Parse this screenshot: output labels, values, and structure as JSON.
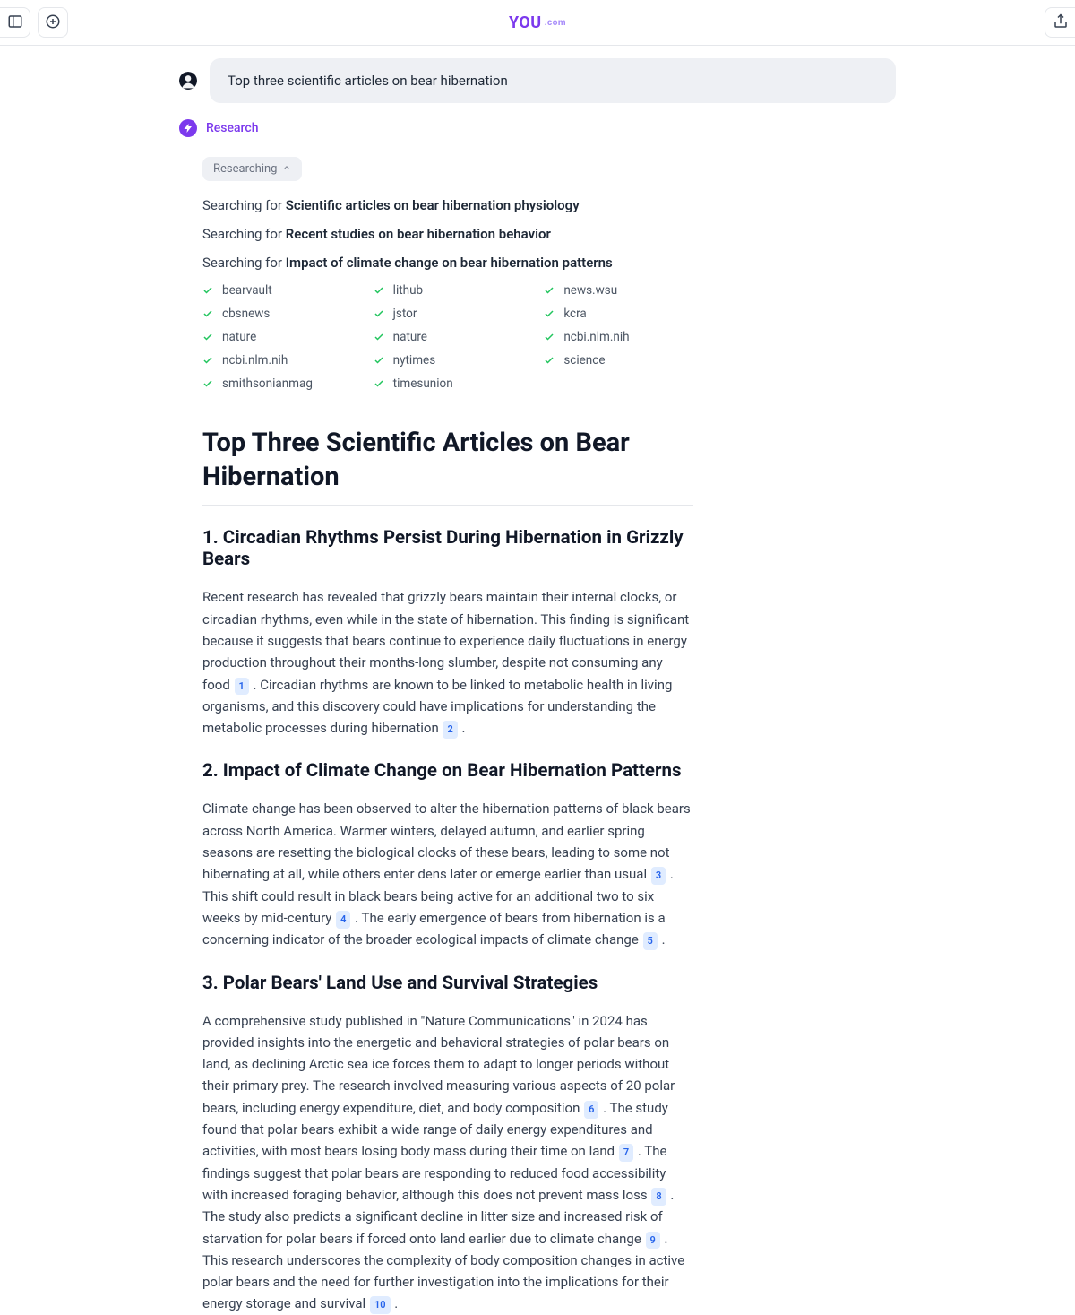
{
  "logo": {
    "text": "YOU",
    "suffix": ".com"
  },
  "query": "Top three scientific articles on bear hibernation",
  "mode": "Research",
  "researching_label": "Researching",
  "search_prefix": "Searching for ",
  "searches": [
    "Scientific articles on bear hibernation physiology",
    "Recent studies on bear hibernation behavior",
    "Impact of climate change on bear hibernation patterns"
  ],
  "sources_col1": [
    "bearvault",
    "cbsnews",
    "nature",
    "ncbi.nlm.nih",
    "smithsonianmag"
  ],
  "sources_col2": [
    "lithub",
    "jstor",
    "nature",
    "nytimes",
    "timesunion"
  ],
  "sources_col3": [
    "news.wsu",
    "kcra",
    "ncbi.nlm.nih",
    "science"
  ],
  "article": {
    "title": "Top Three Scientific Articles on Bear Hibernation",
    "s1": {
      "heading": "1. Circadian Rhythms Persist During Hibernation in Grizzly Bears",
      "p1a": "Recent research has revealed that grizzly bears maintain their internal clocks, or circadian rhythms, even while in the state of hibernation. This finding is significant because it suggests that bears continue to experience daily fluctuations in energy production throughout their months-long slumber, despite not consuming any food ",
      "p1b": " . Circadian rhythms are known to be linked to metabolic health in living organisms, and this discovery could have implications for understanding the metabolic processes during hibernation ",
      "p1c": " ."
    },
    "s2": {
      "heading": "2. Impact of Climate Change on Bear Hibernation Patterns",
      "p2a": "Climate change has been observed to alter the hibernation patterns of black bears across North America. Warmer winters, delayed autumn, and earlier spring seasons are resetting the biological clocks of these bears, leading to some not hibernating at all, while others enter dens later or emerge earlier than usual ",
      "p2b": " . This shift could result in black bears being active for an additional two to six weeks by mid-century ",
      "p2c": " . The early emergence of bears from hibernation is a concerning indicator of the broader ecological impacts of climate change ",
      "p2d": " ."
    },
    "s3": {
      "heading": "3. Polar Bears' Land Use and Survival Strategies",
      "p3a": "A comprehensive study published in \"Nature Communications\" in 2024 has provided insights into the energetic and behavioral strategies of polar bears on land, as declining Arctic sea ice forces them to adapt to longer periods without their primary prey. The research involved measuring various aspects of 20 polar bears, including energy expenditure, diet, and body composition ",
      "p3b": " . The study found that polar bears exhibit a wide range of daily energy expenditures and activities, with most bears losing body mass during their time on land ",
      "p3c": " . The findings suggest that polar bears are responding to reduced food accessibility with increased foraging behavior, although this does not prevent mass loss ",
      "p3d": " . The study also predicts a significant decline in litter size and increased risk of starvation for polar bears if forced onto land earlier due to climate change ",
      "p3e": " . This research underscores the complexity of body composition changes in active polar bears and the need for further investigation into the implications for their energy storage and survival ",
      "p3f": " ."
    }
  },
  "citations": {
    "c1": "1",
    "c2": "2",
    "c3": "3",
    "c4": "4",
    "c5": "5",
    "c6": "6",
    "c7": "7",
    "c8": "8",
    "c9": "9",
    "c10": "10"
  }
}
